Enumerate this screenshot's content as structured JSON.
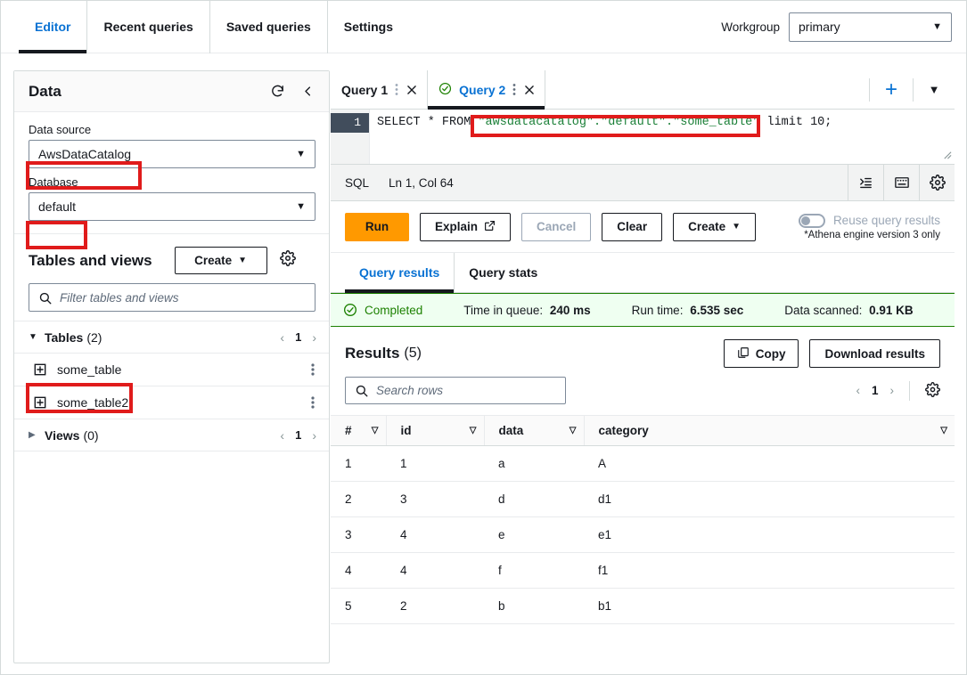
{
  "topnav": {
    "tabs": [
      {
        "label": "Editor",
        "active": true
      },
      {
        "label": "Recent queries",
        "active": false
      },
      {
        "label": "Saved queries",
        "active": false
      },
      {
        "label": "Settings",
        "active": false
      }
    ],
    "workgroup_label": "Workgroup",
    "workgroup_value": "primary",
    "caret": "▼"
  },
  "sidebar": {
    "title": "Data",
    "refresh_icon": "refresh-icon",
    "collapse_icon": "collapse-left-icon",
    "data_source_label": "Data source",
    "data_source_value": "AwsDataCatalog",
    "database_label": "Database",
    "database_value": "default",
    "tables_views_title": "Tables and views",
    "create_label": "Create",
    "create_caret": "▼",
    "settings_icon": "gear-icon",
    "filter_placeholder": "Filter tables and views",
    "tables_group": {
      "name": "Tables",
      "count": "(2)",
      "expanded_icon": "▼",
      "page": "1",
      "prev": "‹",
      "next": "›"
    },
    "tables": [
      {
        "name": "some_table"
      },
      {
        "name": "some_table2"
      }
    ],
    "views_group": {
      "name": "Views",
      "count": "(0)",
      "collapsed_icon": "▶",
      "page": "1",
      "prev": "‹",
      "next": "›"
    }
  },
  "query_tabs": {
    "items": [
      {
        "label": "Query 1",
        "active": false,
        "has_status_icon": false
      },
      {
        "label": "Query 2",
        "active": true,
        "has_status_icon": true
      }
    ],
    "add_label": "+",
    "menu_caret": "▼",
    "close_glyph": "✕",
    "dots_glyph": "⋮"
  },
  "editor": {
    "line_number": "1",
    "sql_prefix": "SELECT * FROM ",
    "sql_identifier": "\"awsdatacatalog\".\"default\".\"some_table\"",
    "sql_suffix": " limit 10;",
    "full_sql": "SELECT * FROM \"awsdatacatalog\".\"default\".\"some_table\" limit 10;"
  },
  "sqlbar": {
    "language": "SQL",
    "position": "Ln 1, Col 64",
    "icons": [
      "format-indent-icon",
      "keyboard-shortcuts-icon",
      "gear-icon"
    ]
  },
  "actions": {
    "run": "Run",
    "explain": "Explain",
    "explain_external_icon": "↗",
    "cancel": "Cancel",
    "clear": "Clear",
    "create": "Create",
    "create_caret": "▼",
    "reuse_label": "Reuse query results",
    "reuse_note": "*Athena engine version 3 only",
    "reuse_enabled": false
  },
  "result_tabs": [
    {
      "label": "Query results",
      "active": true
    },
    {
      "label": "Query stats",
      "active": false
    }
  ],
  "status": {
    "state": "Completed",
    "check_icon": "check-circle-icon",
    "metrics": [
      {
        "key": "Time in queue:",
        "value": "240 ms"
      },
      {
        "key": "Run time:",
        "value": "6.535 sec"
      },
      {
        "key": "Data scanned:",
        "value": "0.91 KB"
      }
    ]
  },
  "results": {
    "title": "Results",
    "count": "(5)",
    "copy_label": "Copy",
    "copy_icon": "copy-icon",
    "download_label": "Download results",
    "search_placeholder": "Search rows",
    "page": "1",
    "prev": "‹",
    "next": "›",
    "settings_icon": "gear-icon",
    "columns": [
      "#",
      "id",
      "data",
      "category"
    ],
    "sort_glyph": "▽",
    "rows": [
      {
        "num": "1",
        "id": "1",
        "data": "a",
        "category": "A"
      },
      {
        "num": "2",
        "id": "3",
        "data": "d",
        "category": "d1"
      },
      {
        "num": "3",
        "id": "4",
        "data": "e",
        "category": "e1"
      },
      {
        "num": "4",
        "id": "4",
        "data": "f",
        "category": "f1"
      },
      {
        "num": "5",
        "id": "2",
        "data": "b",
        "category": "b1"
      }
    ]
  },
  "annotations": {
    "highlight_color": "#e01b1b",
    "boxes": [
      "data-source-value",
      "database-value",
      "some-table-row",
      "sql-table-identifier"
    ]
  },
  "colors": {
    "run_button": "#ff9900",
    "link_blue": "#0972d3",
    "success_green": "#1d8102",
    "sql_string_green": "#1a7f37"
  }
}
